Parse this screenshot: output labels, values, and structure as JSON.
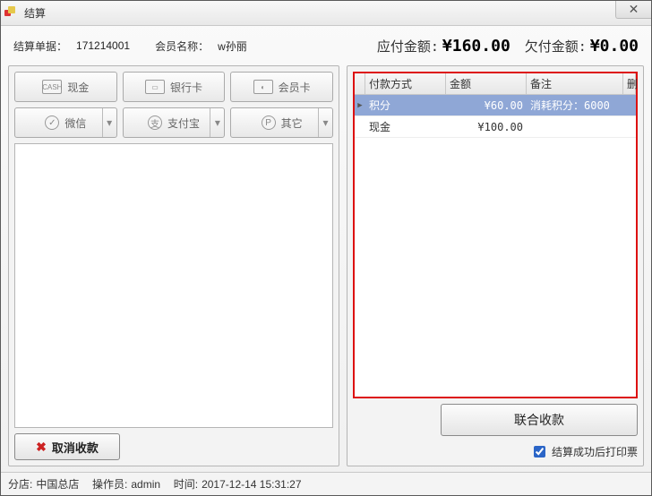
{
  "window": {
    "title": "结算"
  },
  "header": {
    "order_label": "结算单据：",
    "order_no": "171214001",
    "member_label": "会员名称：",
    "member_name": "w孙丽",
    "payable_label": "应付金额:",
    "payable_amount": "¥160.00",
    "due_label": "欠付金额:",
    "due_amount": "¥0.00"
  },
  "pay_buttons": {
    "cash": "现金",
    "bank": "银行卡",
    "member": "会员卡",
    "wechat": "微信",
    "alipay": "支付宝",
    "other": "其它"
  },
  "table": {
    "columns": {
      "method": "付款方式",
      "amount": "金额",
      "remark": "备注",
      "del": "删"
    },
    "rows": [
      {
        "method": "积分",
        "amount": "¥60.00",
        "remark": "消耗积分：6000",
        "selected": true
      },
      {
        "method": "现金",
        "amount": "¥100.00",
        "remark": "",
        "selected": false
      }
    ]
  },
  "actions": {
    "combined_pay": "联合收款",
    "print_checkbox": "结算成功后打印票",
    "print_checked": true,
    "cancel": "取消收款"
  },
  "status": {
    "branch_label": "分店:",
    "branch": "中国总店",
    "operator_label": "操作员:",
    "operator": "admin",
    "time_label": "时间:",
    "time": "2017-12-14 15:31:27"
  }
}
